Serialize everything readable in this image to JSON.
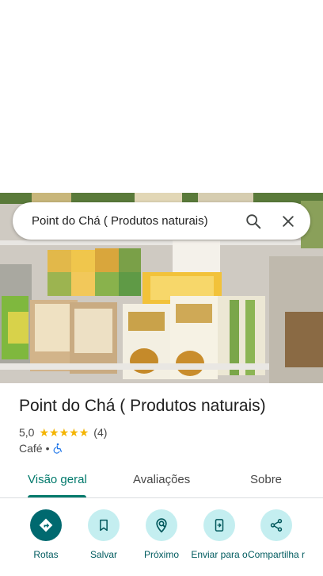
{
  "search": {
    "query": "Point do Chá ( Produtos naturais)"
  },
  "place": {
    "name": "Point do Chá ( Produtos naturais)",
    "rating": "5,0",
    "rating_stars": 5,
    "review_count": "(4)",
    "category": "Café",
    "separator": "•",
    "accessibility_icon": "wheelchair-icon"
  },
  "tabs": [
    {
      "label": "Visão geral",
      "active": true
    },
    {
      "label": "Avaliações",
      "active": false
    },
    {
      "label": "Sobre",
      "active": false
    }
  ],
  "actions": [
    {
      "label": "Rotas",
      "icon": "directions-icon"
    },
    {
      "label": "Salvar",
      "icon": "bookmark-icon"
    },
    {
      "label": "Próximo",
      "icon": "nearby-icon"
    },
    {
      "label": "Enviar para o",
      "icon": "send-to-phone-icon"
    },
    {
      "label": "Compartilha r",
      "icon": "share-icon"
    }
  ],
  "colors": {
    "accent": "#00796b",
    "action_bg": "#c4eef0",
    "primary_action_bg": "#00696f",
    "star": "#f4b400",
    "accessibility": "#1a73e8"
  }
}
